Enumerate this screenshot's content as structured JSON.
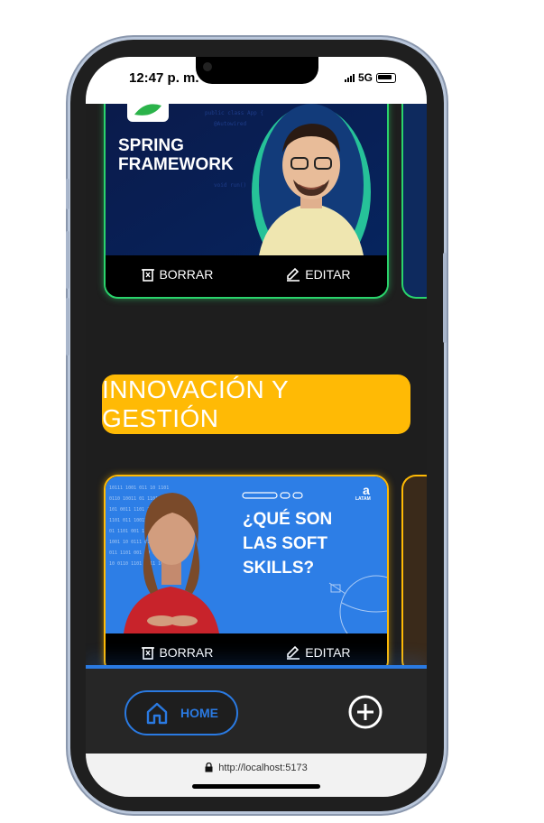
{
  "status_bar": {
    "time": "12:47 p. m.",
    "network": "5G"
  },
  "cards": [
    {
      "thumb_line1": "SPRING",
      "thumb_line2": "FRAMEWORK",
      "delete_label": "BORRAR",
      "edit_label": "EDITAR",
      "border_color": "#2ad46c"
    },
    {
      "thumb_line1": "¿QUÉ SON",
      "thumb_line2": "LAS SOFT",
      "thumb_line3": "SKILLS?",
      "brand": "LATAM",
      "delete_label": "BORRAR",
      "edit_label": "EDITAR",
      "border_color": "#ffba05"
    }
  ],
  "section": {
    "title": "INNOVACIÓN Y GESTIÓN",
    "color": "#ffba05"
  },
  "navbar": {
    "home_label": "HOME",
    "accent": "#2a7ae2"
  },
  "browser": {
    "url": "http://localhost:5173"
  }
}
